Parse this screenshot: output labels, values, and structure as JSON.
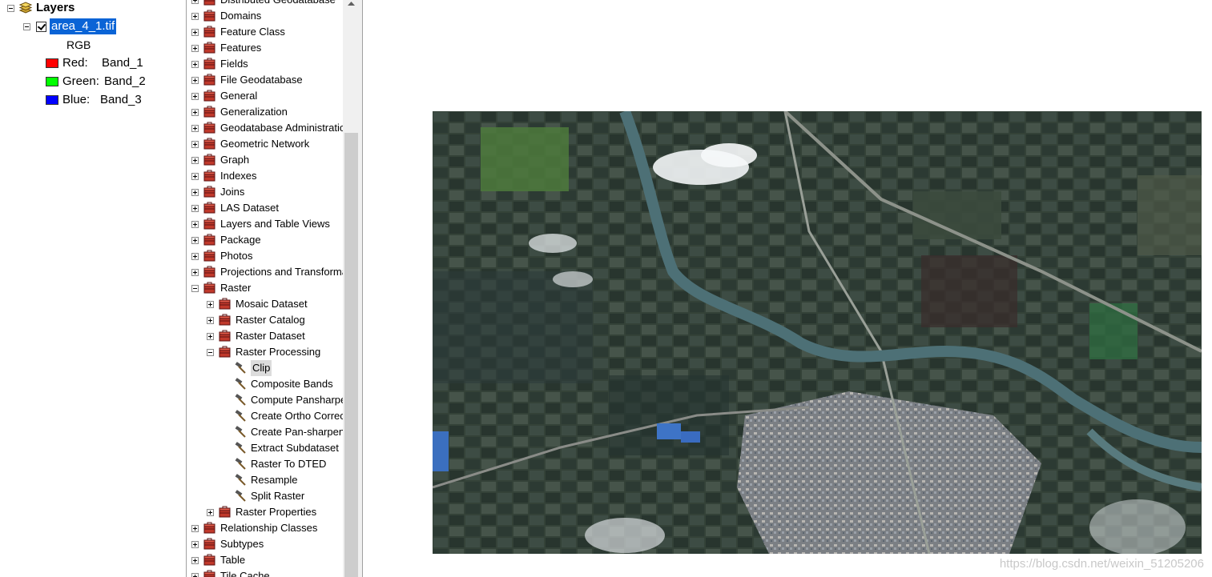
{
  "toc": {
    "root_label": "Layers",
    "layer_name": "area_4_1.tif",
    "renderer": "RGB",
    "bands": [
      {
        "channel": "Red:",
        "band": "Band_1",
        "color": "#ff0000"
      },
      {
        "channel": "Green:",
        "band": "Band_2",
        "color": "#00ff00"
      },
      {
        "channel": "Blue:",
        "band": "Band_3",
        "color": "#0000ff"
      }
    ]
  },
  "catalog": {
    "items": [
      {
        "label": "Distributed Geodatabase",
        "indent": 0,
        "kind": "toolbox",
        "expander": "plus"
      },
      {
        "label": "Domains",
        "indent": 0,
        "kind": "toolbox",
        "expander": "plus"
      },
      {
        "label": "Feature Class",
        "indent": 0,
        "kind": "toolbox",
        "expander": "plus"
      },
      {
        "label": "Features",
        "indent": 0,
        "kind": "toolbox",
        "expander": "plus"
      },
      {
        "label": "Fields",
        "indent": 0,
        "kind": "toolbox",
        "expander": "plus"
      },
      {
        "label": "File Geodatabase",
        "indent": 0,
        "kind": "toolbox",
        "expander": "plus"
      },
      {
        "label": "General",
        "indent": 0,
        "kind": "toolbox",
        "expander": "plus"
      },
      {
        "label": "Generalization",
        "indent": 0,
        "kind": "toolbox",
        "expander": "plus"
      },
      {
        "label": "Geodatabase Administration",
        "indent": 0,
        "kind": "toolbox",
        "expander": "plus"
      },
      {
        "label": "Geometric Network",
        "indent": 0,
        "kind": "toolbox",
        "expander": "plus"
      },
      {
        "label": "Graph",
        "indent": 0,
        "kind": "toolbox",
        "expander": "plus"
      },
      {
        "label": "Indexes",
        "indent": 0,
        "kind": "toolbox",
        "expander": "plus"
      },
      {
        "label": "Joins",
        "indent": 0,
        "kind": "toolbox",
        "expander": "plus"
      },
      {
        "label": "LAS Dataset",
        "indent": 0,
        "kind": "toolbox",
        "expander": "plus"
      },
      {
        "label": "Layers and Table Views",
        "indent": 0,
        "kind": "toolbox",
        "expander": "plus"
      },
      {
        "label": "Package",
        "indent": 0,
        "kind": "toolbox",
        "expander": "plus"
      },
      {
        "label": "Photos",
        "indent": 0,
        "kind": "toolbox",
        "expander": "plus"
      },
      {
        "label": "Projections and Transformations",
        "indent": 0,
        "kind": "toolbox",
        "expander": "plus"
      },
      {
        "label": "Raster",
        "indent": 0,
        "kind": "toolbox",
        "expander": "minus"
      },
      {
        "label": "Mosaic Dataset",
        "indent": 1,
        "kind": "toolbox",
        "expander": "plus"
      },
      {
        "label": "Raster Catalog",
        "indent": 1,
        "kind": "toolbox",
        "expander": "plus"
      },
      {
        "label": "Raster Dataset",
        "indent": 1,
        "kind": "toolbox",
        "expander": "plus"
      },
      {
        "label": "Raster Processing",
        "indent": 1,
        "kind": "toolbox",
        "expander": "minus"
      },
      {
        "label": "Clip",
        "indent": 2,
        "kind": "tool",
        "expander": "none",
        "selected": true
      },
      {
        "label": "Composite Bands",
        "indent": 2,
        "kind": "tool",
        "expander": "none"
      },
      {
        "label": "Compute Pansharpen Weights",
        "indent": 2,
        "kind": "tool",
        "expander": "none"
      },
      {
        "label": "Create Ortho Corrected Raster Dataset",
        "indent": 2,
        "kind": "tool",
        "expander": "none"
      },
      {
        "label": "Create Pan-sharpened Raster Dataset",
        "indent": 2,
        "kind": "tool",
        "expander": "none"
      },
      {
        "label": "Extract Subdataset",
        "indent": 2,
        "kind": "tool",
        "expander": "none"
      },
      {
        "label": "Raster To DTED",
        "indent": 2,
        "kind": "tool",
        "expander": "none"
      },
      {
        "label": "Resample",
        "indent": 2,
        "kind": "tool",
        "expander": "none"
      },
      {
        "label": "Split Raster",
        "indent": 2,
        "kind": "tool",
        "expander": "none"
      },
      {
        "label": "Raster Properties",
        "indent": 1,
        "kind": "toolbox",
        "expander": "plus"
      },
      {
        "label": "Relationship Classes",
        "indent": 0,
        "kind": "toolbox",
        "expander": "plus"
      },
      {
        "label": "Subtypes",
        "indent": 0,
        "kind": "toolbox",
        "expander": "plus"
      },
      {
        "label": "Table",
        "indent": 0,
        "kind": "toolbox",
        "expander": "plus"
      },
      {
        "label": "Tile Cache",
        "indent": 0,
        "kind": "toolbox",
        "expander": "plus"
      }
    ]
  },
  "map": {
    "watermark": "https://blog.csdn.net/weixin_51205206"
  },
  "colors": {
    "selection_blue": "#0a64d6",
    "water": "#4d7076",
    "field_dark": "#2f3d36"
  }
}
